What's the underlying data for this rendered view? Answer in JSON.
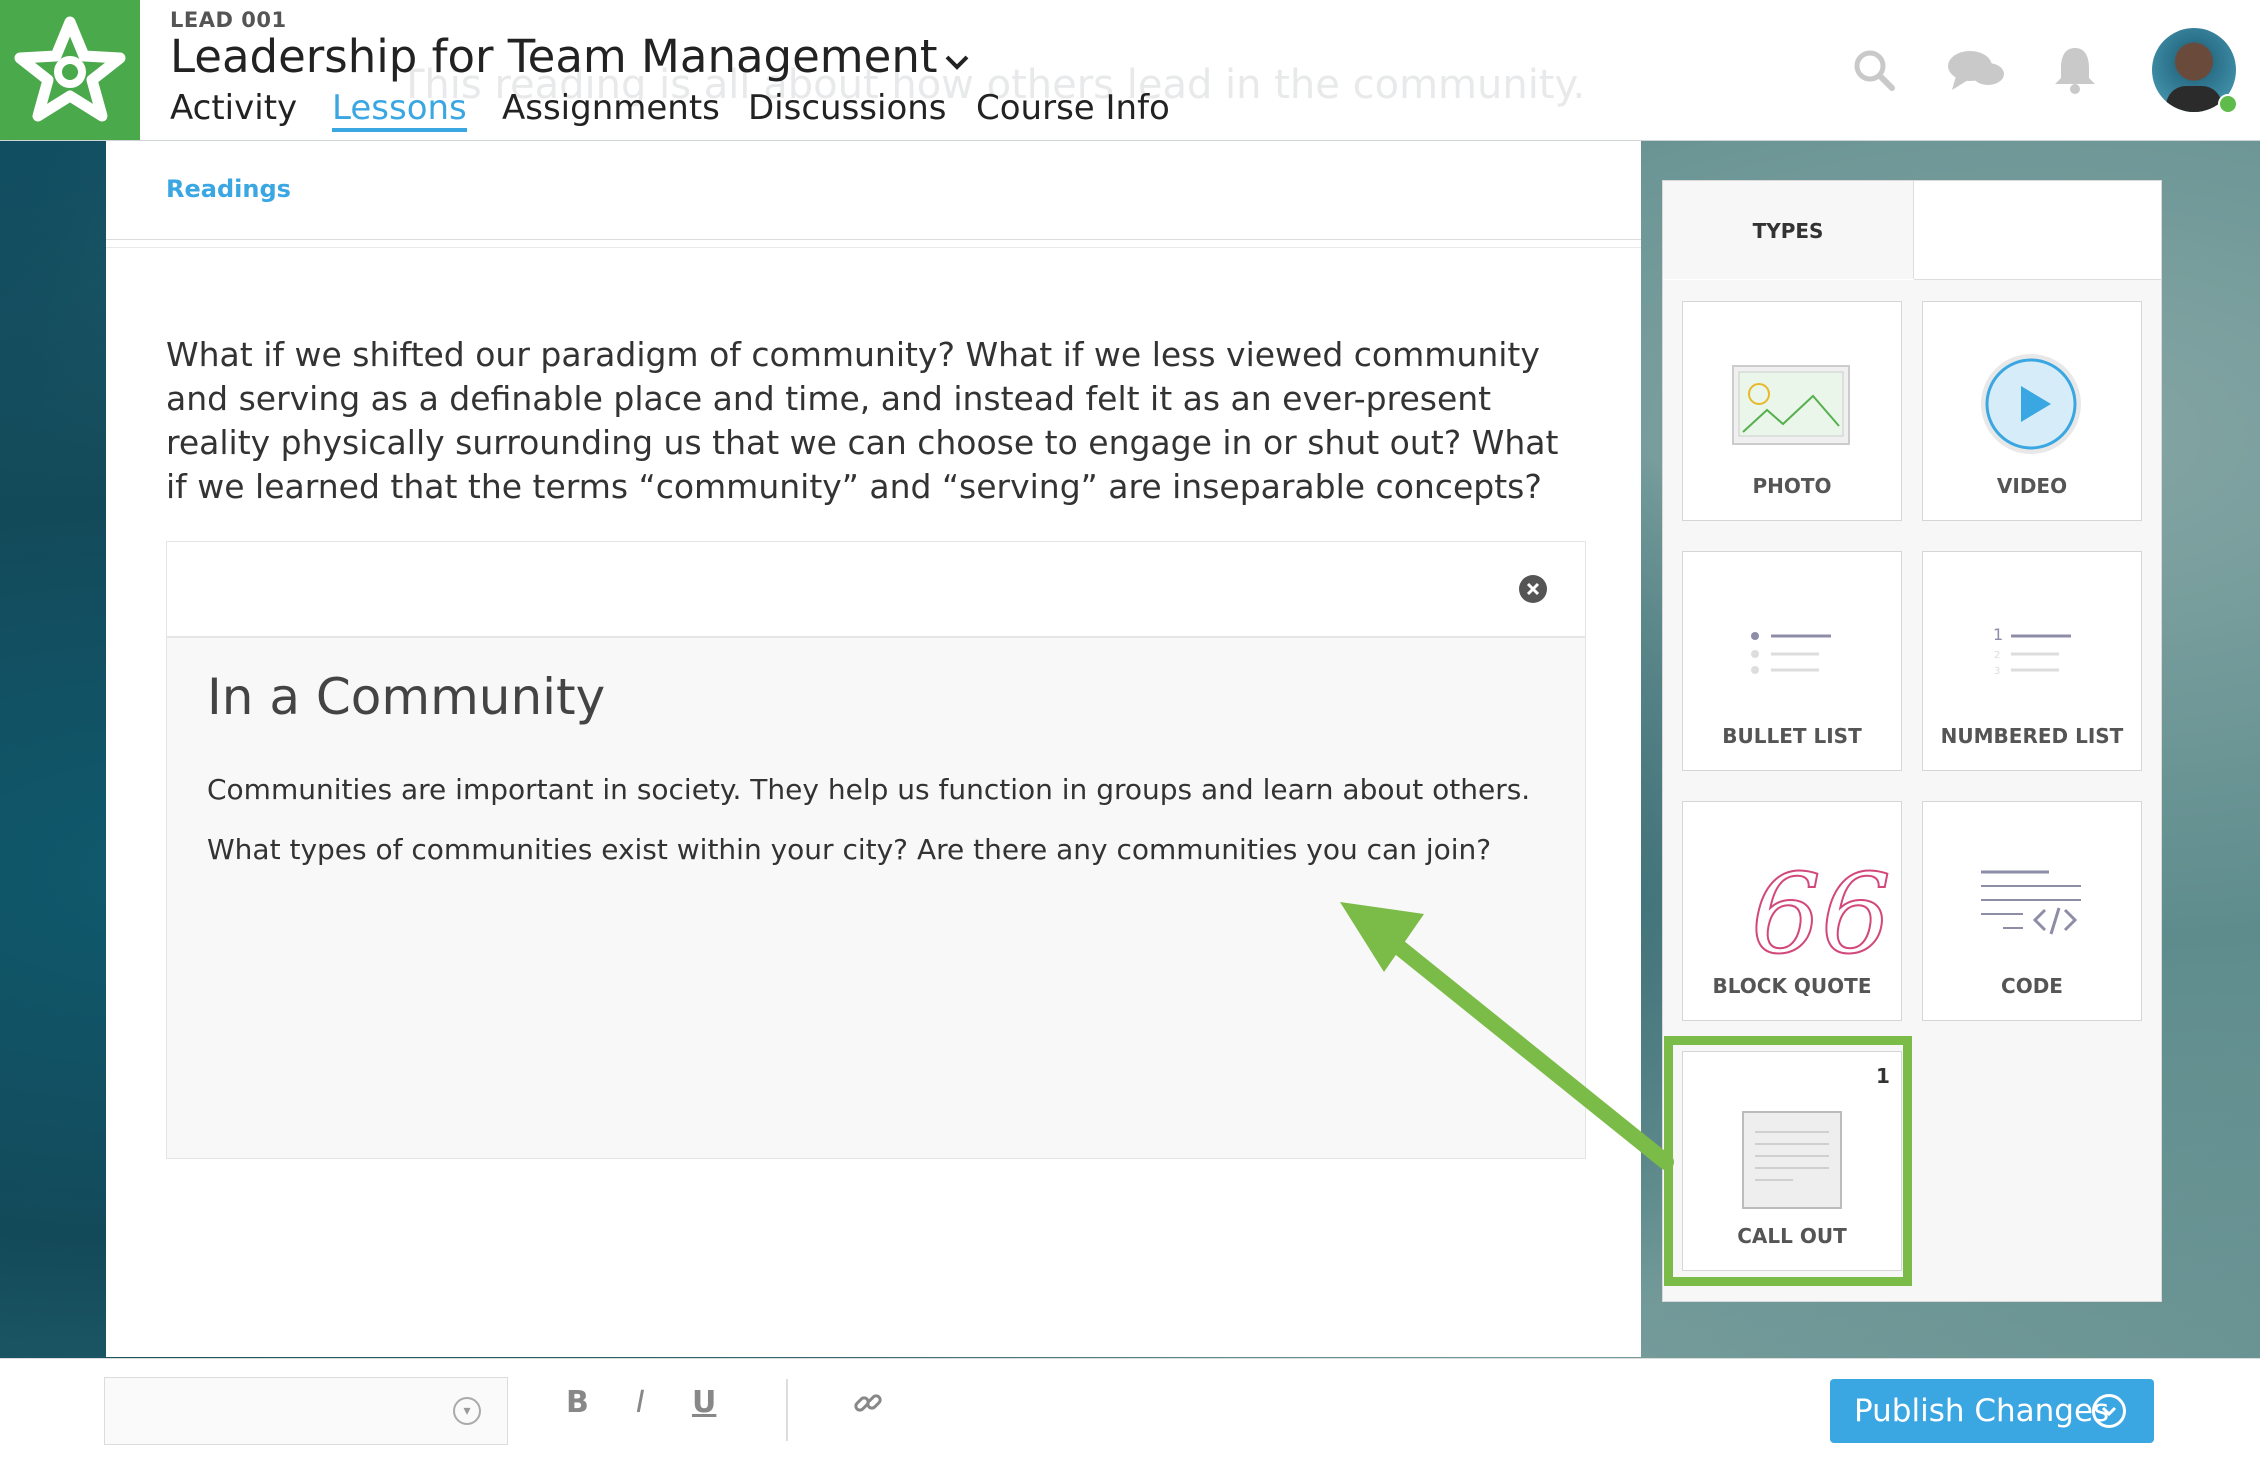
{
  "header": {
    "course_code": "LEAD 001",
    "course_title": "Leadership for Team Management",
    "ghost_text": "This reading is all about how others lead in the community.",
    "tabs": [
      "Activity",
      "Lessons",
      "Assignments",
      "Discussions",
      "Course Info"
    ],
    "active_tab": "Lessons",
    "icons": [
      "search-icon",
      "chat-icon",
      "bell-icon"
    ]
  },
  "main": {
    "breadcrumb": "Readings",
    "paragraph": "What if we shifted our paradigm of community? What if we less viewed community and serving as a definable place and time, and instead felt it as an ever-present reality physically surrounding us that we can choose to engage in or shut out? What if we learned that the terms “community” and “serving” are inseparable concepts?",
    "callout": {
      "title": "In a Community",
      "text": "Communities are important in society. They help us function in groups and learn about others.  What types of communities exist within your city? Are there any communities you can join?"
    }
  },
  "types_panel": {
    "tab_label": "TYPES",
    "tiles": {
      "photo": "PHOTO",
      "video": "VIDEO",
      "bullet_list": "BULLET LIST",
      "numbered_list": "NUMBERED LIST",
      "block_quote": "BLOCK QUOTE",
      "code": "CODE",
      "call_out": "CALL OUT"
    },
    "call_out_count": "1"
  },
  "toolbar": {
    "bold": "B",
    "italic": "I",
    "underline": "U",
    "publish_label": "Publish Changes"
  },
  "colors": {
    "brand_green": "#4aa94a",
    "accent_blue": "#3aa6e2",
    "highlight_green": "#7bbb47"
  }
}
